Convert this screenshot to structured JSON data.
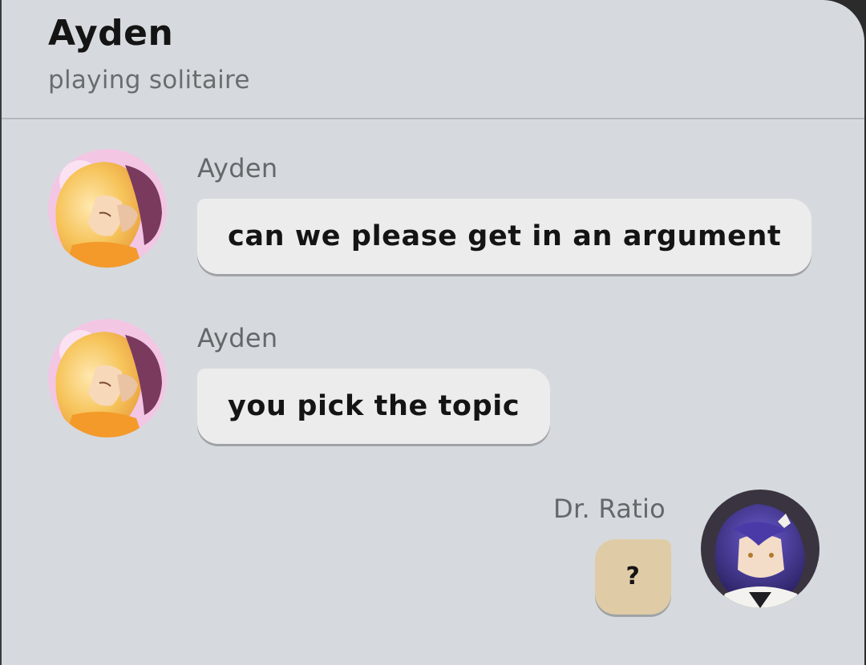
{
  "header": {
    "title": "Ayden",
    "status": "playing solitaire"
  },
  "messages": [
    {
      "sender": "Ayden",
      "text": "can we please get in an argument",
      "direction": "incoming",
      "avatar": "ayden-avatar"
    },
    {
      "sender": "Ayden",
      "text": "you pick the topic",
      "direction": "incoming",
      "avatar": "ayden-avatar"
    },
    {
      "sender": "Dr. Ratio",
      "text": "?",
      "direction": "outgoing",
      "avatar": "dr-ratio-avatar"
    }
  ],
  "colors": {
    "background": "#d6dade",
    "incoming_bubble": "#ececec",
    "outgoing_bubble": "#dfcca6",
    "title_text": "#141414",
    "muted_text": "#6a6d70"
  }
}
